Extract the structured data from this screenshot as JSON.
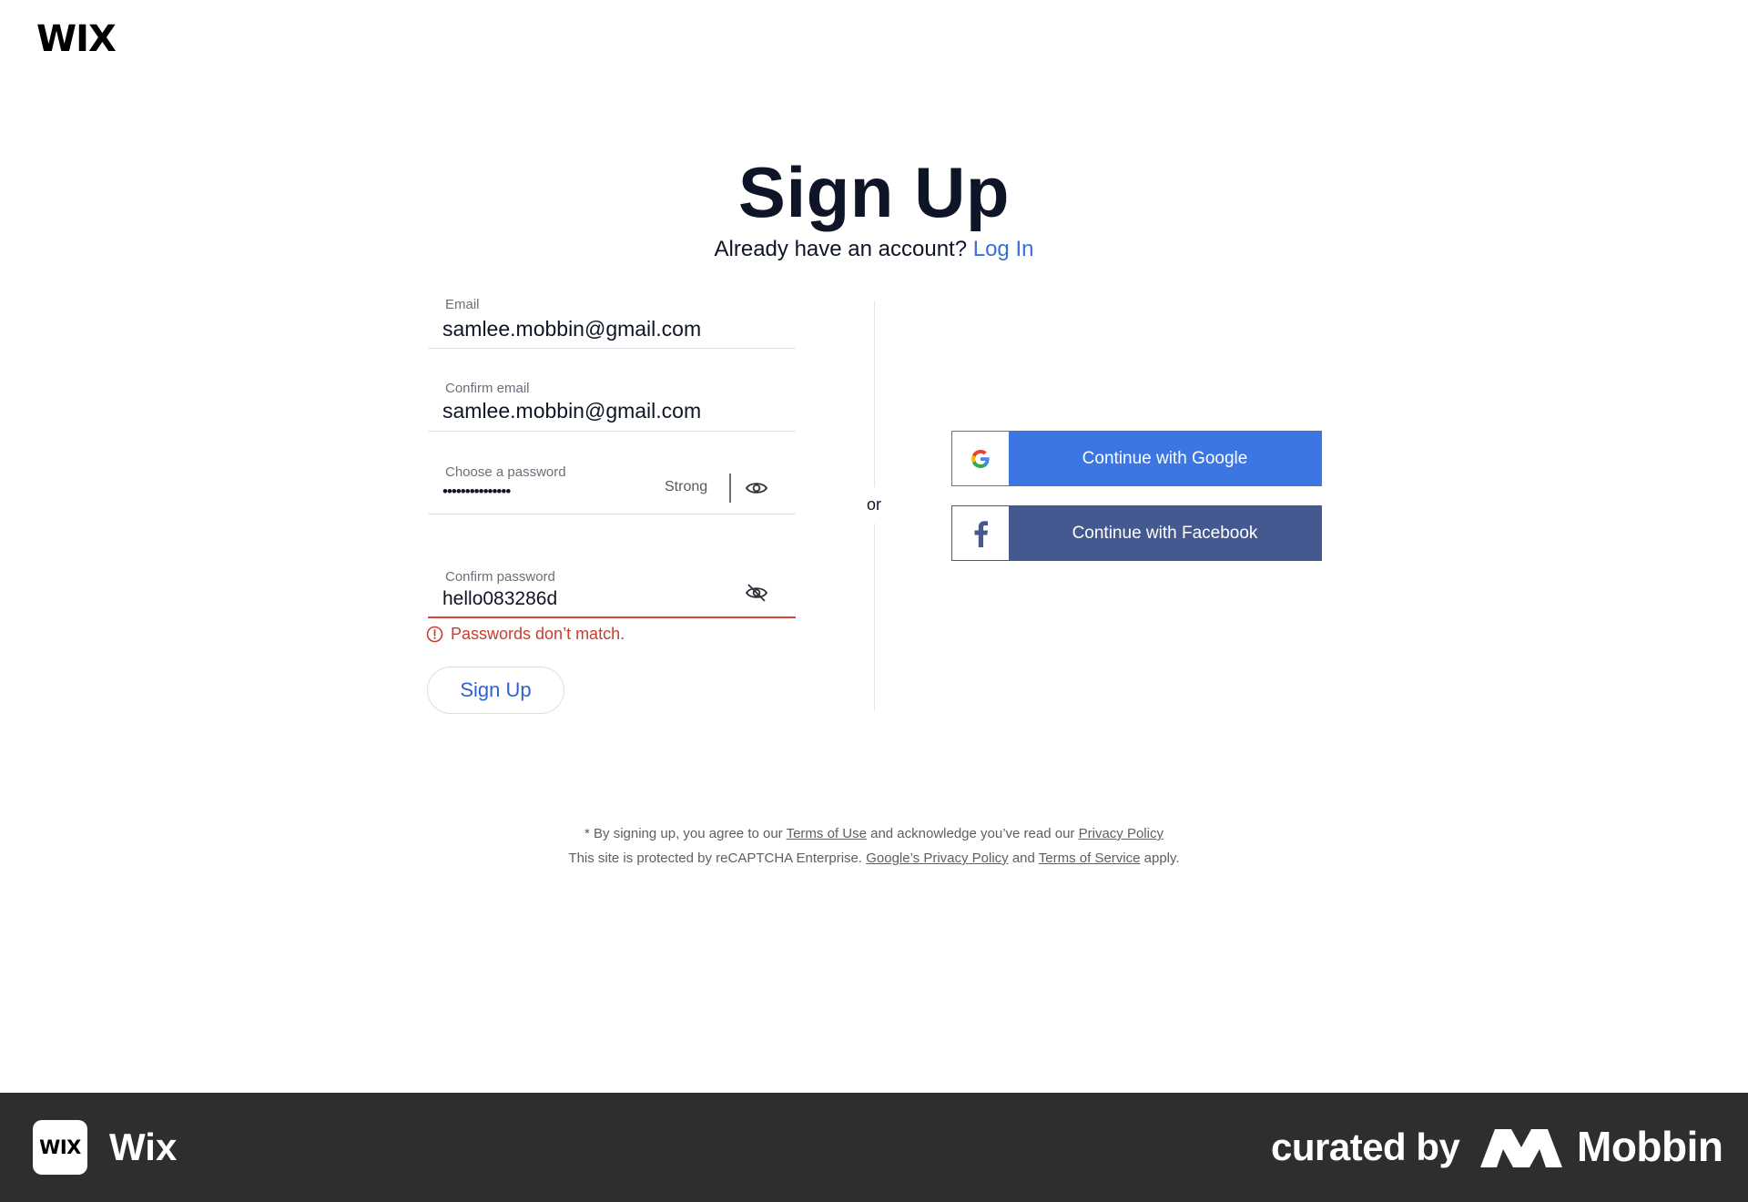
{
  "header": {
    "logo": "WIX"
  },
  "hero": {
    "title": "Sign Up",
    "subtitle_text": "Already have an account?",
    "login_link": "Log In"
  },
  "form": {
    "email": {
      "label": "Email",
      "value": "samlee.mobbin@gmail.com"
    },
    "confirm_email": {
      "label": "Confirm email",
      "value": "samlee.mobbin@gmail.com"
    },
    "password": {
      "label": "Choose a password",
      "value": "•••••••••••••••",
      "strength": "Strong"
    },
    "confirm_password": {
      "label": "Confirm password",
      "value": "hello083286d"
    },
    "error_message": "Passwords don’t match.",
    "submit_label": "Sign Up"
  },
  "divider": {
    "or": "or"
  },
  "social": {
    "google_label": "Continue with Google",
    "facebook_label": "Continue with Facebook"
  },
  "legal": {
    "line1_prefix": "* By signing up, you agree to our",
    "terms_of_use": "Terms of Use",
    "line1_middle": "and acknowledge you’ve read our",
    "privacy_policy": "Privacy Policy",
    "line2_prefix": "This site is protected by reCAPTCHA Enterprise.",
    "google_privacy": "Google’s Privacy Policy",
    "line2_and": "and",
    "terms_of_service": "Terms of Service",
    "line2_suffix": "apply."
  },
  "footer": {
    "app_icon_text": "WIX",
    "app_name": "Wix",
    "curated_by": "curated by",
    "brand": "Mobbin"
  },
  "colors": {
    "accent": "#3a6fd8",
    "google_blue": "#3b76e3",
    "facebook_blue": "#44598f",
    "error": "#c93d2f",
    "footer_bg": "#2e2e2e"
  }
}
